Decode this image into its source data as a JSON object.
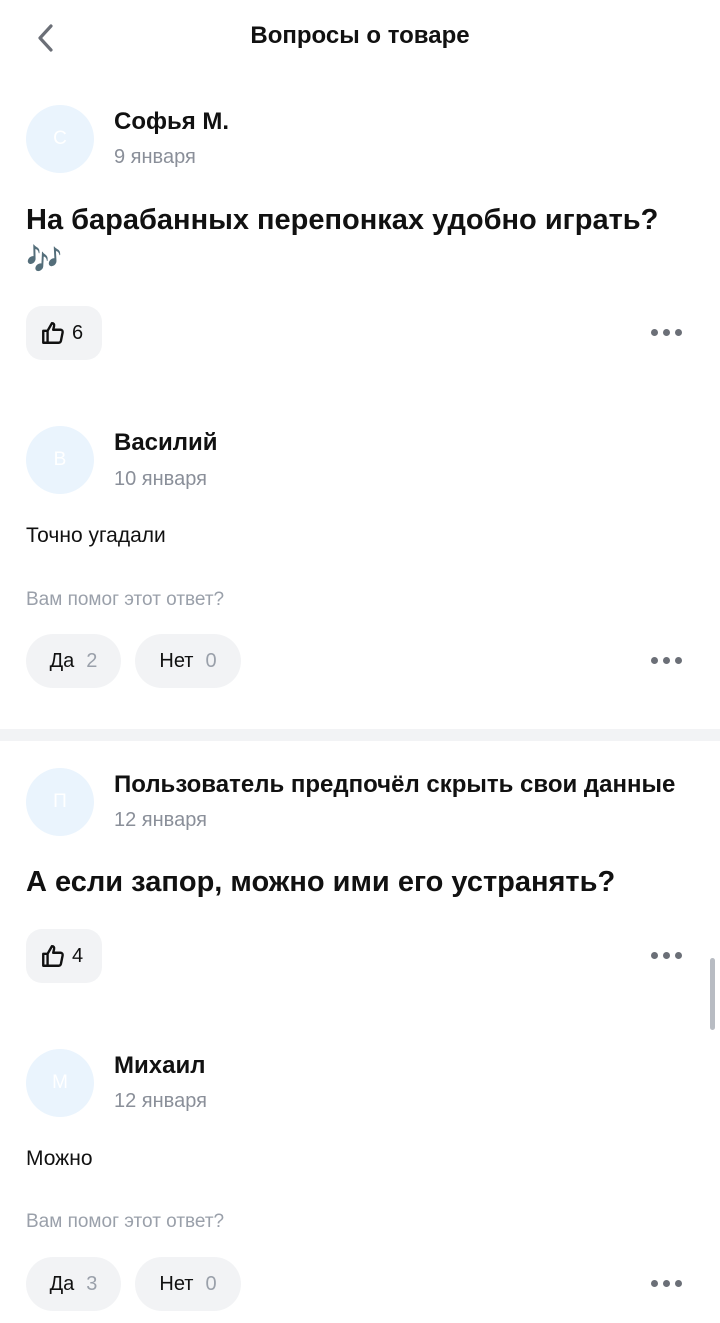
{
  "header": {
    "title": "Вопросы о товаре",
    "back_icon": "chevron-left-icon"
  },
  "threads": [
    {
      "question": {
        "avatar_letter": "С",
        "author": "Софья М.",
        "date": "9 января",
        "text": "На барабанных перепонках удобно играть? 🎶",
        "likes": "6"
      },
      "answer": {
        "avatar_letter": "В",
        "author": "Василий",
        "date": "10 января",
        "text": "Точно угадали",
        "helpful_label": "Вам помог этот ответ?",
        "yes_label": "Да",
        "yes_count": "2",
        "no_label": "Нет",
        "no_count": "0"
      }
    },
    {
      "question": {
        "avatar_letter": "П",
        "author": "Пользователь предпочёл скрыть свои данные",
        "date": "12 января",
        "text": "А если запор, можно ими его устранять?",
        "likes": "4"
      },
      "answer": {
        "avatar_letter": "М",
        "author": "Михаил",
        "date": "12 января",
        "text": "Можно",
        "helpful_label": "Вам помог этот ответ?",
        "yes_label": "Да",
        "yes_count": "3",
        "no_label": "Нет",
        "no_count": "0"
      }
    }
  ],
  "colors": {
    "avatar_bg": "#eaf4fd",
    "chip_bg": "#f2f3f5",
    "muted_text": "#9aa0aa",
    "primary_text": "#111111"
  }
}
